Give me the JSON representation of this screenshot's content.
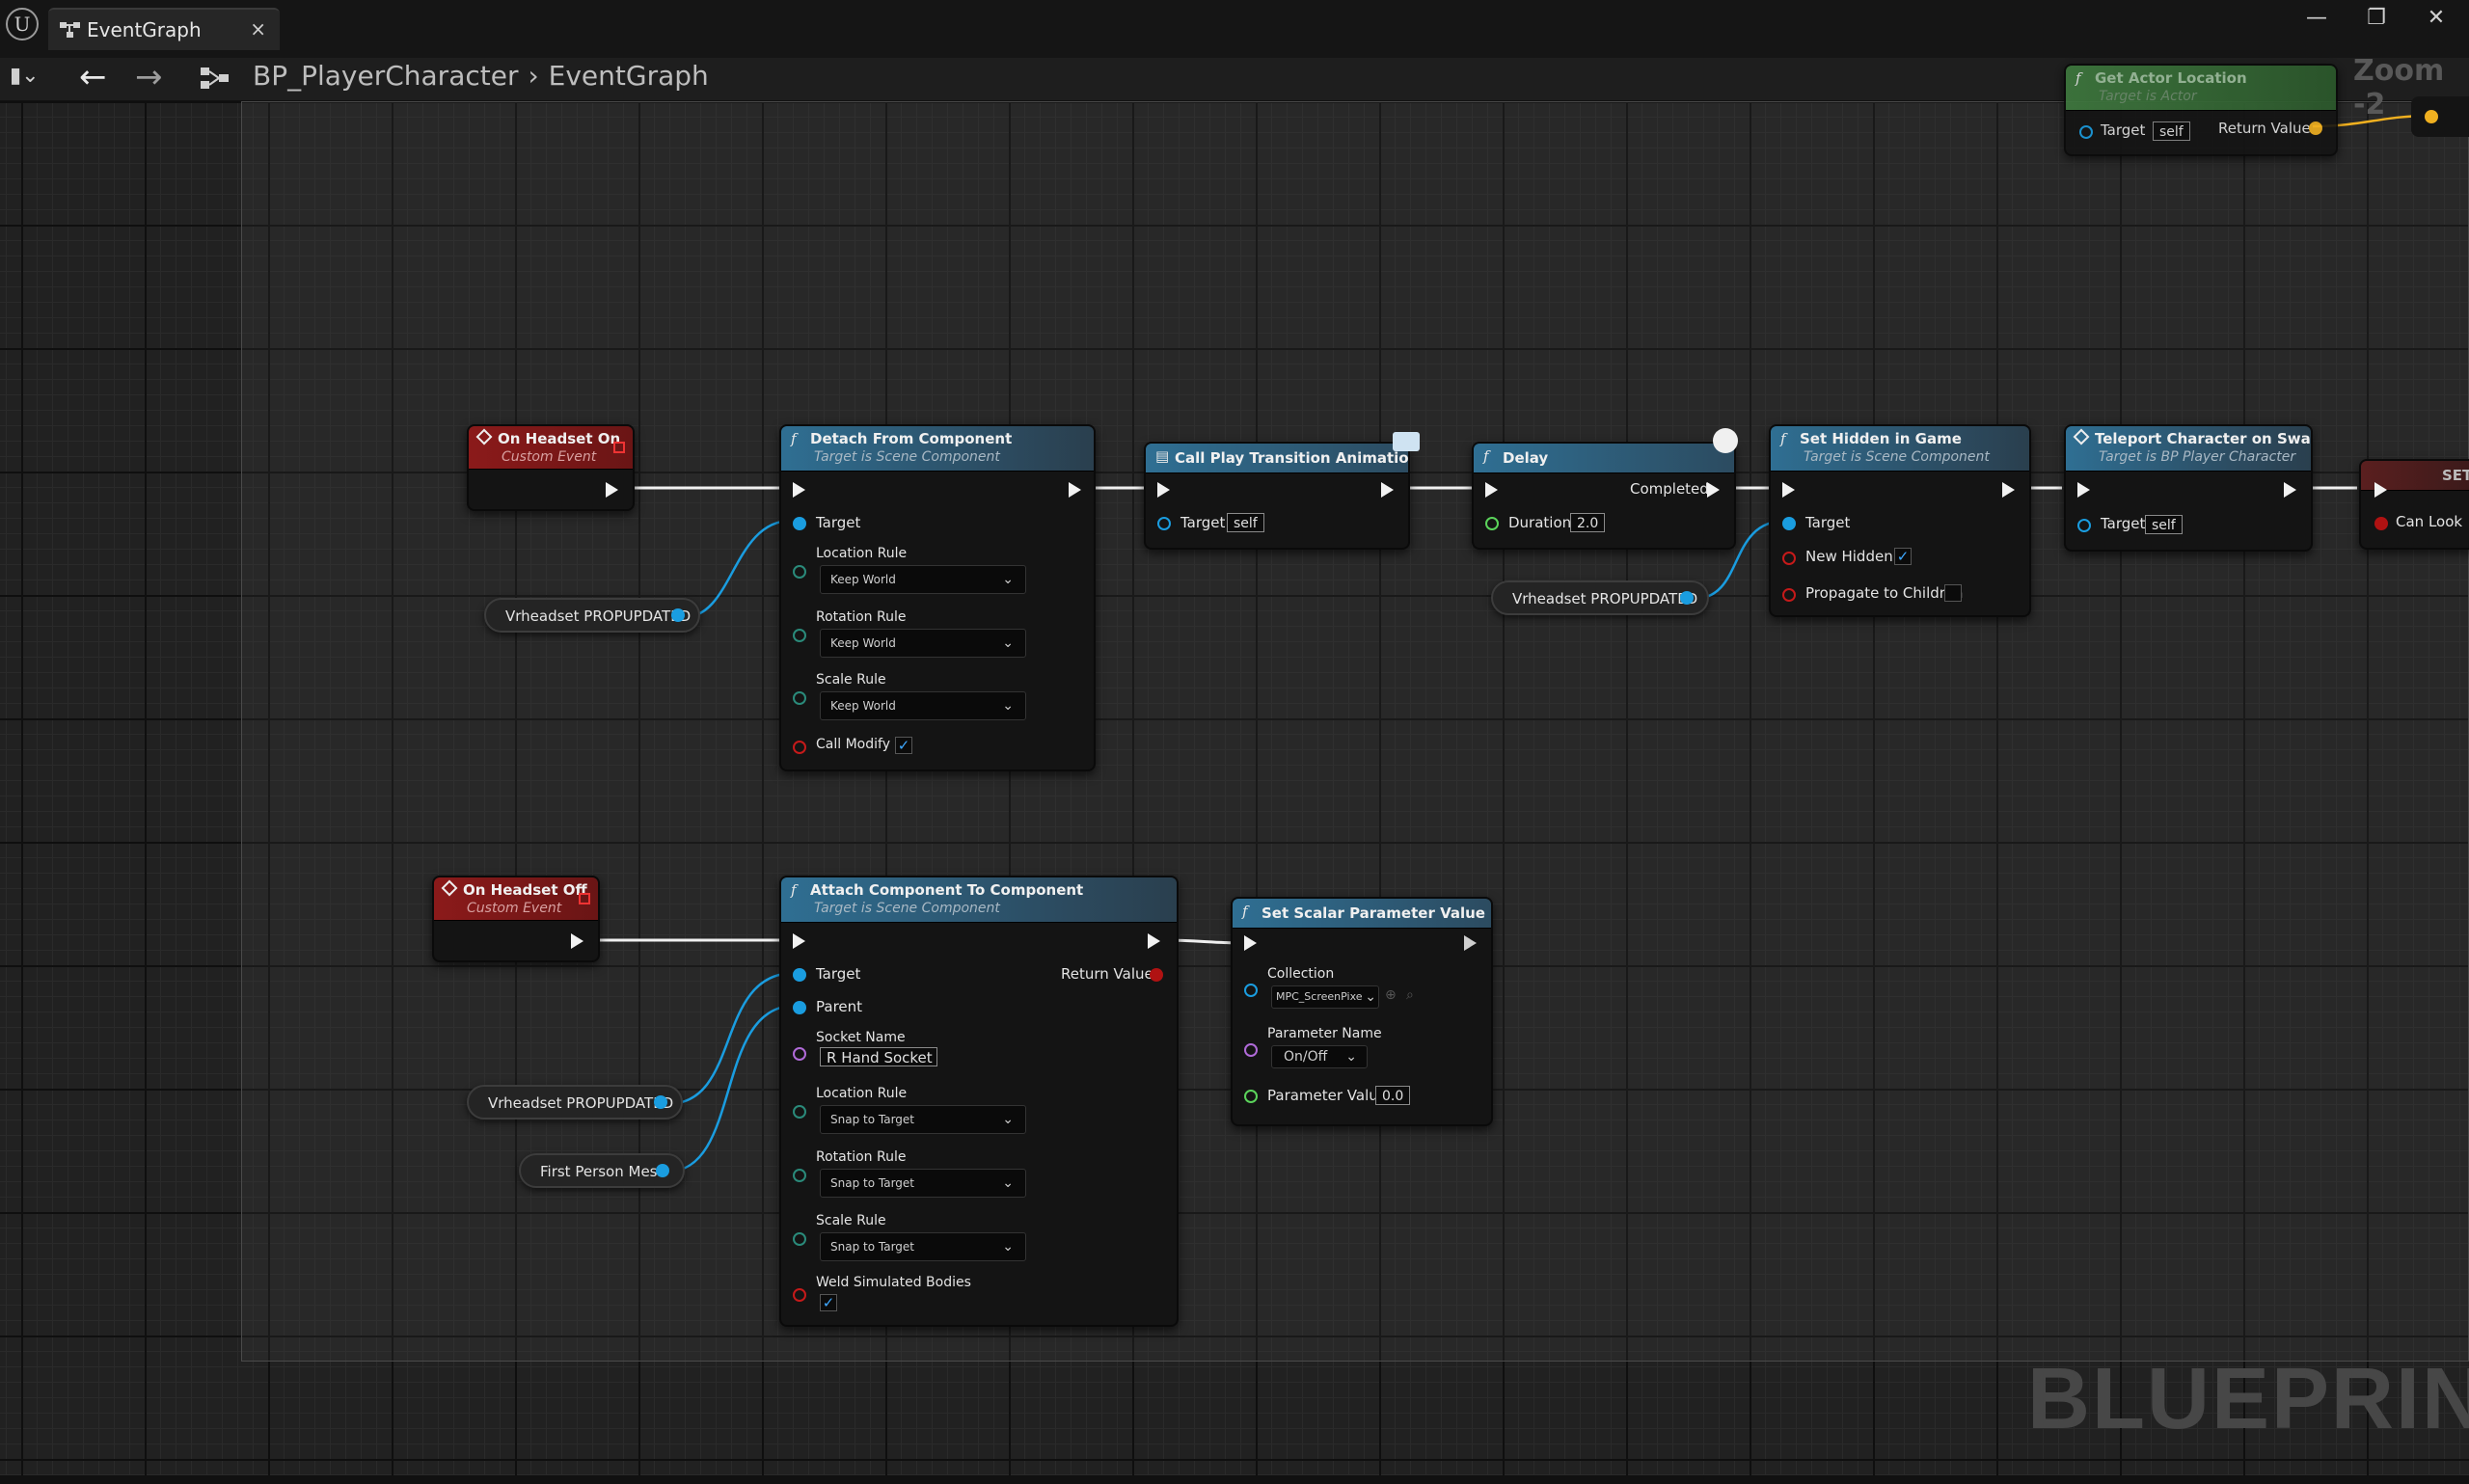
{
  "window": {
    "tab_label": "EventGraph",
    "tab_close": "×",
    "minimize": "—",
    "restore": "❐",
    "close": "✕"
  },
  "toolbar": {
    "breadcrumb_root": "BP_PlayerCharacter",
    "breadcrumb_separator": "›",
    "breadcrumb_current": "EventGraph",
    "back_icon": "←",
    "forward_icon": "→"
  },
  "graph": {
    "zoom_label": "Zoom -2",
    "watermark": "BLUEPRINT"
  },
  "nodes": {
    "get_actor_location": {
      "title": "Get Actor Location",
      "subtitle": "Target is Actor",
      "target_label": "Target",
      "target_value": "self",
      "return_label": "Return Value"
    },
    "on_headset_on": {
      "title": "On Headset On",
      "subtitle": "Custom Event"
    },
    "on_headset_off": {
      "title": "On Headset Off",
      "subtitle": "Custom Event"
    },
    "detach": {
      "title": "Detach From Component",
      "subtitle": "Target is Scene Component",
      "target_label": "Target",
      "location_rule_label": "Location Rule",
      "location_rule_value": "Keep World",
      "rotation_rule_label": "Rotation Rule",
      "rotation_rule_value": "Keep World",
      "scale_rule_label": "Scale Rule",
      "scale_rule_value": "Keep World",
      "call_modify_label": "Call Modify"
    },
    "call_play": {
      "title": "Call Play Transition Animation",
      "target_label": "Target",
      "target_value": "self"
    },
    "delay": {
      "title": "Delay",
      "completed_label": "Completed",
      "duration_label": "Duration",
      "duration_value": "2.0"
    },
    "set_hidden": {
      "title": "Set Hidden in Game",
      "subtitle": "Target is Scene Component",
      "target_label": "Target",
      "new_hidden_label": "New Hidden",
      "propagate_label": "Propagate to Children"
    },
    "teleport": {
      "title": "Teleport Character on Swap",
      "subtitle": "Target is BP Player Character",
      "target_label": "Target",
      "target_value": "self"
    },
    "set_partial": {
      "title": "SET",
      "can_look_label": "Can Look"
    },
    "attach": {
      "title": "Attach Component To Component",
      "subtitle": "Target is Scene Component",
      "target_label": "Target",
      "parent_label": "Parent",
      "return_label": "Return Value",
      "socket_label": "Socket Name",
      "socket_value": "R Hand Socket",
      "location_rule_label": "Location Rule",
      "location_rule_value": "Snap to Target",
      "rotation_rule_label": "Rotation Rule",
      "rotation_rule_value": "Snap to Target",
      "scale_rule_label": "Scale Rule",
      "scale_rule_value": "Snap to Target",
      "weld_label": "Weld Simulated Bodies"
    },
    "set_scalar": {
      "title": "Set Scalar Parameter Value",
      "collection_label": "Collection",
      "collection_value": "MPC_ScreenPixe",
      "param_name_label": "Parameter Name",
      "param_name_value": "On/Off",
      "param_value_label": "Parameter Value",
      "param_value_value": "0.0"
    }
  },
  "variables": {
    "vrheadset_1": "Vrheadset PROPUPDATED",
    "vrheadset_2": "Vrheadset PROPUPDATED",
    "vrheadset_3": "Vrheadset PROPUPDATED",
    "first_person_mesh": "First Person Mesh"
  },
  "colors": {
    "function_header": "#2f6f93",
    "event_header": "#8b1a1a",
    "pure_header": "#3f7a3f",
    "object_pin": "#1a9de0",
    "float_pin": "#5bd35b",
    "bool_pin": "#c51a1a",
    "name_pin": "#b06ad8",
    "vector_pin": "#f0b020",
    "checkbox_check": "#3ea8ff"
  }
}
